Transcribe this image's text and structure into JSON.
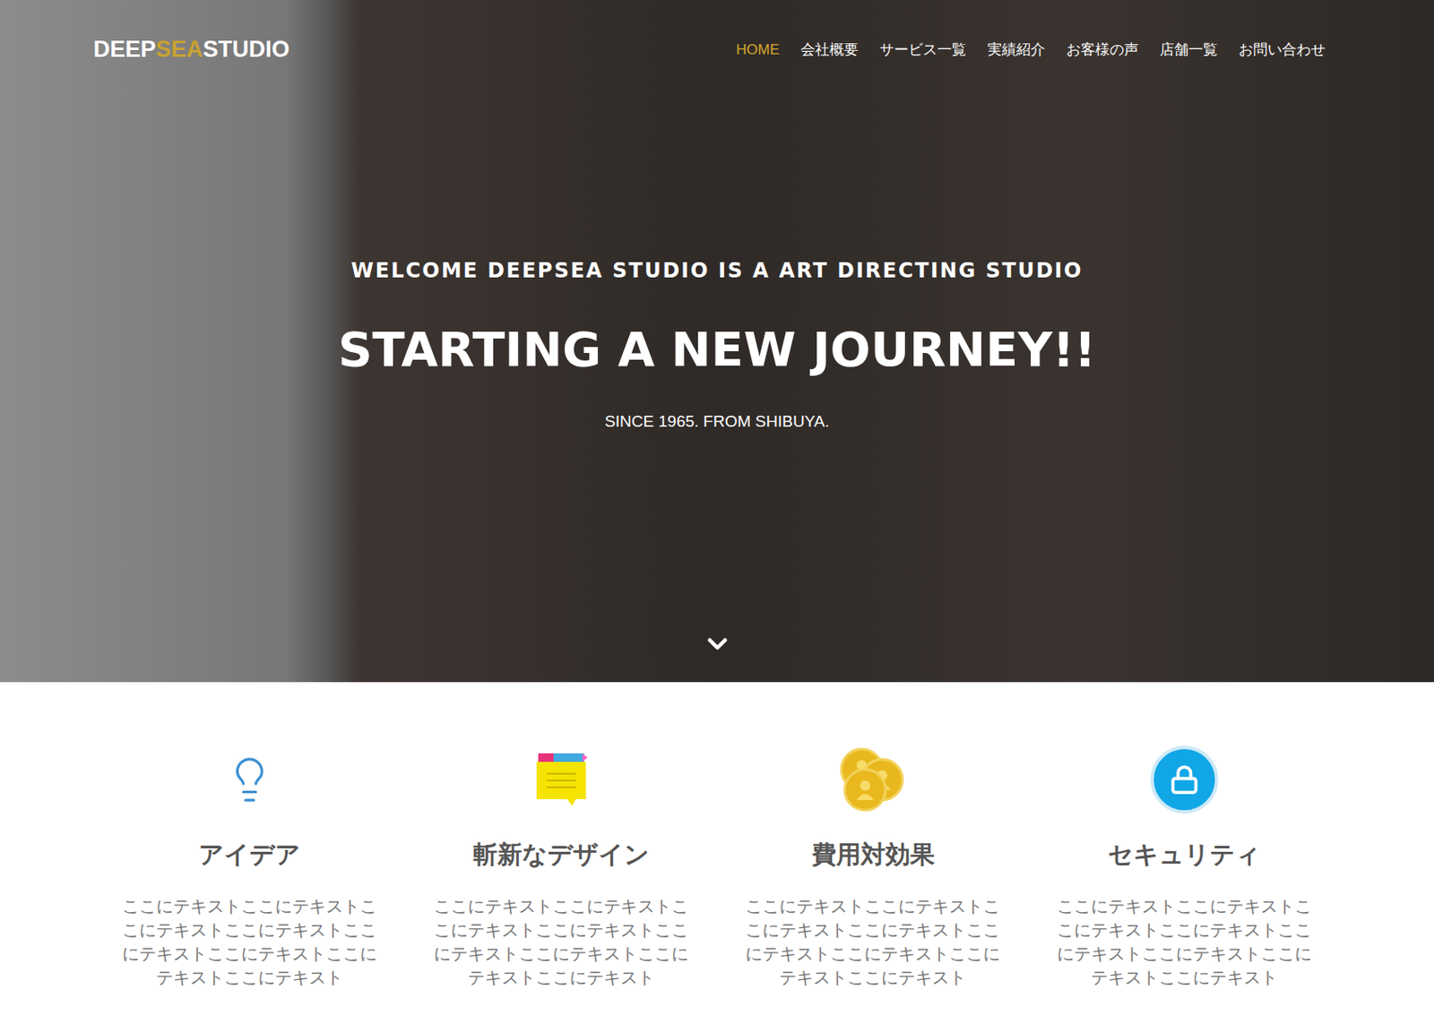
{
  "header": {
    "logo": [
      {
        "text": "DEEP",
        "color": "#ffffff"
      },
      {
        "text": "SEA",
        "color": "#c9a232"
      },
      {
        "text": "STUDIO",
        "color": "#ffffff"
      }
    ],
    "nav": [
      {
        "label": "HOME",
        "selected": true
      },
      {
        "label": "会社概要",
        "selected": false
      },
      {
        "label": "サービス一覧",
        "selected": false
      },
      {
        "label": "実績紹介",
        "selected": false
      },
      {
        "label": "お客様の声",
        "selected": false
      },
      {
        "label": "店舗一覧",
        "selected": false
      },
      {
        "label": "お問い合わせ",
        "selected": false
      }
    ]
  },
  "hero": {
    "welcome": "WELCOME DEEPSEA STUDIO IS A ART DIRECTING STUDIO",
    "title": "STARTING A NEW JOURNEY!!",
    "subtitle": "SINCE 1965. FROM SHIBUYA."
  },
  "features": [
    {
      "kind": "bulb",
      "title": "アイデア",
      "text": "ここにテキストここにテキストここにテキストここにテキストここにテキストここにテキストここにテキストここにテキスト"
    },
    {
      "kind": "note",
      "title": "斬新なデザイン",
      "text": "ここにテキストここにテキストここにテキストここにテキストここにテキストここにテキストここにテキストここにテキスト"
    },
    {
      "kind": "coins",
      "title": "費用対効果",
      "text": "ここにテキストここにテキストここにテキストここにテキストここにテキストここにテキストここにテキストここにテキスト"
    },
    {
      "kind": "lock",
      "title": "セキュリティ",
      "text": "ここにテキストここにテキストここにテキストここにテキストここにテキストここにテキストここにテキストここにテキスト"
    }
  ]
}
